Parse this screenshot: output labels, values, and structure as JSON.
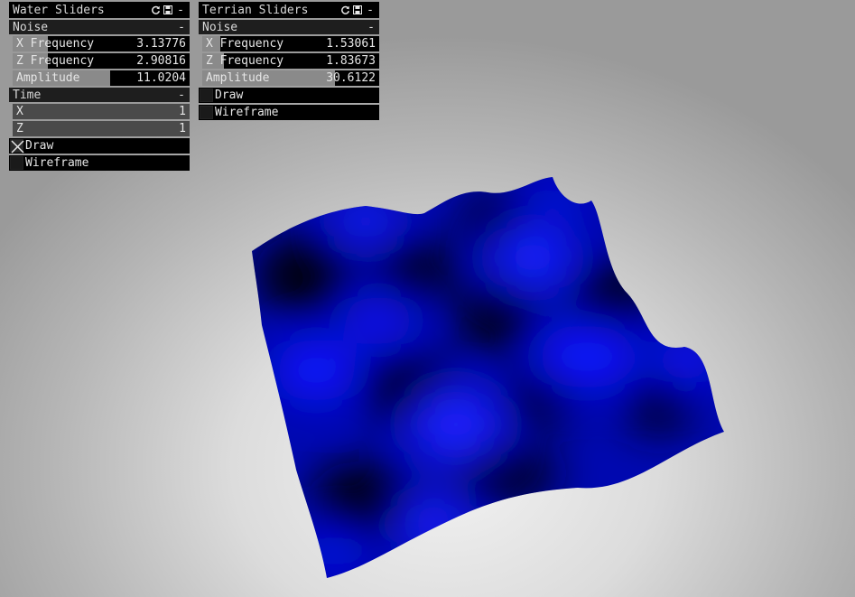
{
  "water_panel": {
    "title": "Water Sliders",
    "icons": [
      "refresh-icon",
      "save-icon",
      "minimize-icon"
    ],
    "minimize_label": "-",
    "noise": {
      "label": "Noise",
      "toggle": "-",
      "x_frequency": {
        "label": "X Frequency",
        "value": "3.13776",
        "fill_fraction": 0.2
      },
      "z_frequency": {
        "label": "Z Frequency",
        "value": "2.90816",
        "fill_fraction": 0.2
      },
      "amplitude": {
        "label": "Amplitude",
        "value": "11.0204",
        "fill_fraction": 0.55
      }
    },
    "time": {
      "label": "Time",
      "toggle": "-",
      "x": {
        "label": "X",
        "value": "1"
      },
      "z": {
        "label": "Z",
        "value": "1"
      }
    },
    "draw": {
      "label": "Draw",
      "checked": true
    },
    "wireframe": {
      "label": "Wireframe",
      "checked": false
    }
  },
  "terrain_panel": {
    "title": "Terrian Sliders",
    "icons": [
      "refresh-icon",
      "save-icon",
      "minimize-icon"
    ],
    "minimize_label": "-",
    "noise": {
      "label": "Noise",
      "toggle": "-",
      "x_frequency": {
        "label": "X Frequency",
        "value": "1.53061",
        "fill_fraction": 0.1
      },
      "z_frequency": {
        "label": "Z Frequency",
        "value": "1.83673",
        "fill_fraction": 0.12
      },
      "amplitude": {
        "label": "Amplitude",
        "value": "30.6122",
        "fill_fraction": 0.75
      }
    },
    "draw": {
      "label": "Draw",
      "checked": false
    },
    "wireframe": {
      "label": "Wireframe",
      "checked": false
    }
  },
  "scene": {
    "mesh_color": "#0a14ff",
    "shadow_color": "#000000"
  }
}
